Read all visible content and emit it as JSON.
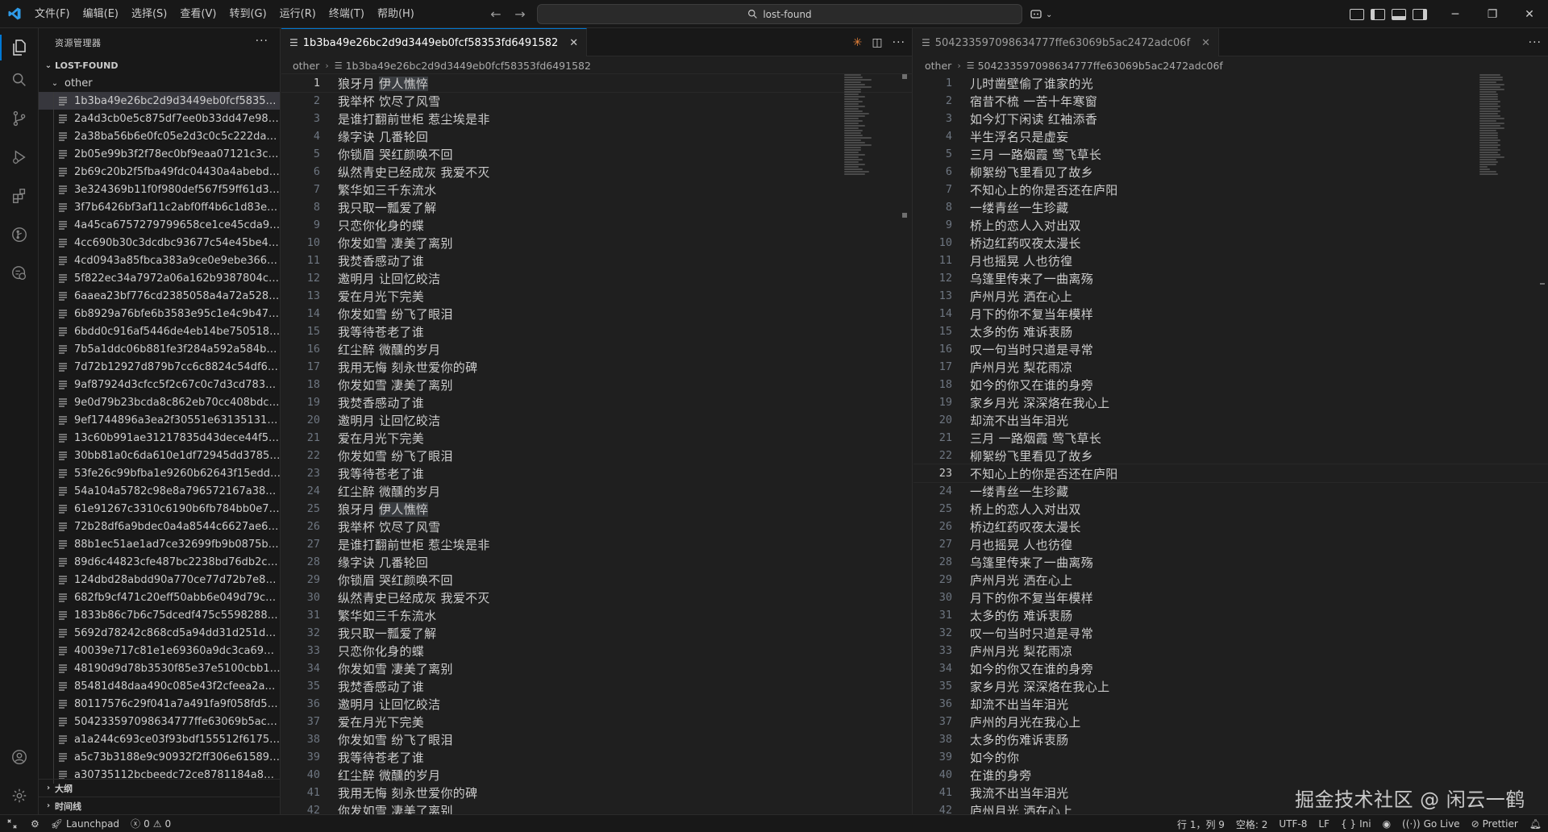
{
  "titlebar": {
    "menus": [
      "文件(F)",
      "编辑(E)",
      "选择(S)",
      "查看(V)",
      "转到(G)",
      "运行(R)",
      "终端(T)",
      "帮助(H)"
    ],
    "search_text": "lost-found",
    "accent": "#0078d4"
  },
  "sidebar": {
    "title": "资源管理器",
    "root_folder": "LOST-FOUND",
    "subfolder": "other",
    "files": [
      "1b3ba49e26bc2d9d3449eb0fcf58353fd649…",
      "2a4d3cb0e5c875df7ee0b33dd47e98288bc5…",
      "2a38ba56b6e0fc05e2d3c0c5c222da6e6c8a…",
      "2b05e99b3f2f78ec0bf9eaa07121c3c98c424f…",
      "2b69c20b2f5fba49fdc04430a4abebd3c2d2…",
      "3e324369b11f0f980def567f59ff61d3f1025a60",
      "3f7b6426bf3af11c2abf0ff4b6c1d83e681a25…",
      "4a45ca6757279799658ce1ce45cda98d9f46…",
      "4cc690b30c3dcdbc93677c54e45be44071db…",
      "4cd0943a85fbca383a9ce0e9ebe36611074ff…",
      "5f822ec34a7972a06a162b9387804cce2d3e…",
      "6aaea23bf776cd2385058a4a72a52853fcc0f…",
      "6b8929a76bfe6b3583e95c1e4c9b477fa904f…",
      "6bdd0c916af5446de4eb14be75051892ab10…",
      "7b5a1ddc06b881fe3f284a592a584b6ff4ec6…",
      "7d72b12927d879b7cc6c8824c54df68cbdfdf…",
      "9af87924d3cfcc5f2c67c0c7d3cd783c0c76af52",
      "9e0d79b23bcda8c862eb70cc408bdccebb17…",
      "9ef1744896a3ea2f30551e631351315323b2…",
      "13c60b991ae31217835d43dece44f5ba256d…",
      "30bb81a0c6da610e1df72945dd3785f4456c…",
      "53fe26c99bfba1e9260b62643f15edd1b470c…",
      "54a104a5782c98e8a796572167a38011c080…",
      "61e91267c3310c6190b6fb784bb0e7a2c77e…",
      "72b28df6a9bdec0a4a8544c6627ae6ca217a…",
      "88b1ec51ae1ad7ce32699fb9b0875b49e93c…",
      "89d6c44823cfe487bc2238bd76db2c6093a4…",
      "124dbd28abdd90a770ce77d72b7e809c53c…",
      "682fb9cf471c20eff50abb6e049d79cd2ca04…",
      "1833b86c7b6c75dcedf475c559828849ea9f…",
      "5692d78242c868cd5a94dd31d251d9fc7255…",
      "40039e717c81e1e69360a9dc3ca69a48c97a…",
      "48190d9d78b3530f85e37e5100cbb12397e0…",
      "85481d48daa490c085e43f2cfeea2ae80ade0…",
      "80117576c29f041a7a491fa9f058fd55cf9fc0ab",
      "504233597098634777ffe63069b5ac2472ad…",
      "a1a244c693ce03f93bdf155512f6175f66f062…",
      "a5c73b3188e9c90932f2ff306e61589508b09…",
      "a30735112bcbeedc72ce8781184a86a66d1a…"
    ],
    "selected_index": 0,
    "outline_label": "大纲",
    "timeline_label": "时间线"
  },
  "editor_left": {
    "tab_title": "1b3ba49e26bc2d9d3449eb0fcf58353fd6491582",
    "breadcrumb_folder": "other",
    "breadcrumb_file": "1b3ba49e26bc2d9d3449eb0fcf58353fd6491582",
    "current_line": 1,
    "lines": [
      "狼牙月 伊人憔悴",
      "我举杯 饮尽了风雪",
      "是谁打翻前世柜 惹尘埃是非",
      "缘字诀 几番轮回",
      "你锁眉 哭红颜唤不回",
      "纵然青史已经成灰 我爱不灭",
      "繁华如三千东流水",
      "我只取一瓢爱了解",
      "只恋你化身的蝶",
      "你发如雪 凄美了离别",
      "我焚香感动了谁",
      "邀明月 让回忆皎洁",
      "爱在月光下完美",
      "你发如雪 纷飞了眼泪",
      "我等待苍老了谁",
      "红尘醉 微醺的岁月",
      "我用无悔 刻永世爱你的碑",
      "你发如雪 凄美了离别",
      "我焚香感动了谁",
      "邀明月 让回忆皎洁",
      "爱在月光下完美",
      "你发如雪 纷飞了眼泪",
      "我等待苍老了谁",
      "红尘醉 微醺的岁月",
      "狼牙月 伊人憔悴",
      "我举杯 饮尽了风雪",
      "是谁打翻前世柜 惹尘埃是非",
      "缘字诀 几番轮回",
      "你锁眉 哭红颜唤不回",
      "纵然青史已经成灰 我爱不灭",
      "繁华如三千东流水",
      "我只取一瓢爱了解",
      "只恋你化身的蝶",
      "你发如雪 凄美了离别",
      "我焚香感动了谁",
      "邀明月 让回忆皎洁",
      "爱在月光下完美",
      "你发如雪 纷飞了眼泪",
      "我等待苍老了谁",
      "红尘醉 微醺的岁月",
      "我用无悔 刻永世爱你的碑",
      "你发如雪 凄美了离别"
    ]
  },
  "editor_right": {
    "tab_title": "504233597098634777ffe63069b5ac2472adc06f",
    "breadcrumb_folder": "other",
    "breadcrumb_file": "504233597098634777ffe63069b5ac2472adc06f",
    "current_line": 23,
    "lines": [
      "儿时凿壁偷了谁家的光",
      "宿昔不梳 一苦十年寒窗",
      "如今灯下闲读 红袖添香",
      "半生浮名只是虚妄",
      "三月 一路烟霞 莺飞草长",
      "柳絮纷飞里看见了故乡",
      "不知心上的你是否还在庐阳",
      "一缕青丝一生珍藏",
      "桥上的恋人入对出双",
      "桥边红药叹夜太漫长",
      "月也摇晃 人也彷徨",
      "乌篷里传来了一曲离殇",
      "庐州月光 洒在心上",
      "月下的你不复当年模样",
      "太多的伤 难诉衷肠",
      "叹一句当时只道是寻常",
      "庐州月光 梨花雨凉",
      "如今的你又在谁的身旁",
      "家乡月光 深深烙在我心上",
      "却流不出当年泪光",
      "三月 一路烟霞 莺飞草长",
      "柳絮纷飞里看见了故乡",
      "不知心上的你是否还在庐阳",
      "一缕青丝一生珍藏",
      "桥上的恋人入对出双",
      "桥边红药叹夜太漫长",
      "月也摇晃 人也彷徨",
      "乌篷里传来了一曲离殇",
      "庐州月光 洒在心上",
      "月下的你不复当年模样",
      "太多的伤 难诉衷肠",
      "叹一句当时只道是寻常",
      "庐州月光 梨花雨凉",
      "如今的你又在谁的身旁",
      "家乡月光 深深烙在我心上",
      "却流不出当年泪光",
      "庐州的月光在我心上",
      "太多的伤难诉衷肠",
      "如今的你",
      "在谁的身旁",
      "我流不出当年泪光",
      "庐州月光 洒在心上"
    ]
  },
  "statusbar": {
    "launchpad": "Launchpad",
    "errors": "0",
    "warnings": "0",
    "position": "行 1，列 9",
    "spaces": "空格: 2",
    "encoding": "UTF-8",
    "eol": "LF",
    "language": "Ini",
    "golive": "Go Live",
    "prettier": "Prettier"
  },
  "watermark": "掘金技术社区 @ 闲云一鹤"
}
